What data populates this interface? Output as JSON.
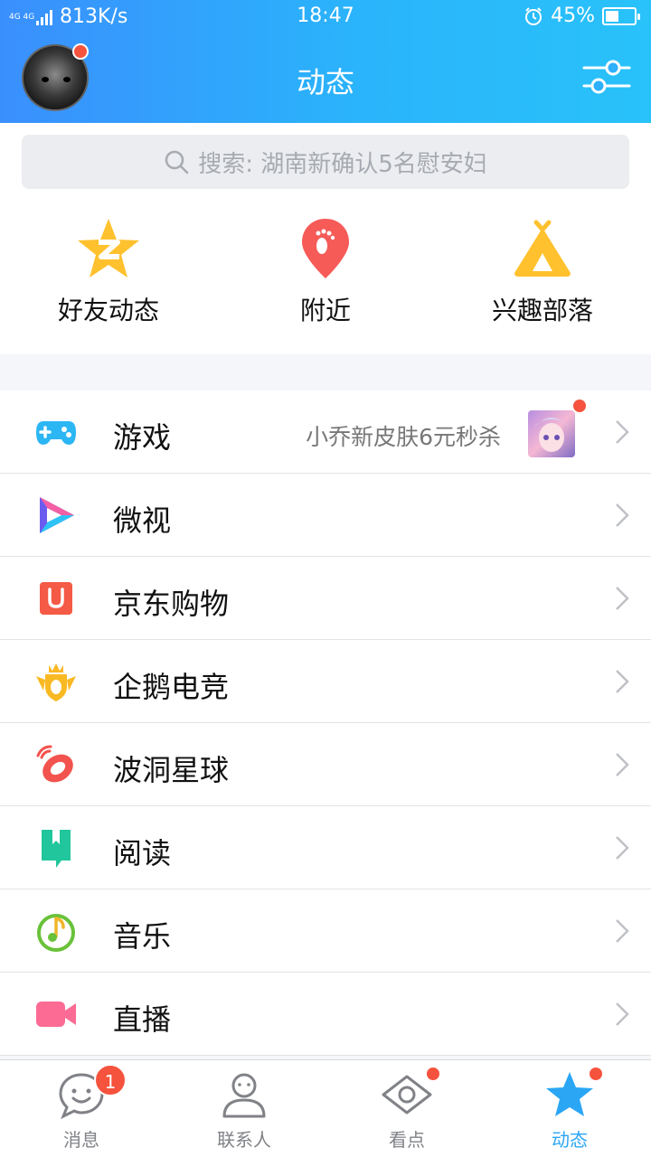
{
  "status_bar": {
    "network_tag": "4G 4G",
    "speed": "813K/s",
    "time": "18:47",
    "battery_percent": "45%",
    "battery_level": 0.45
  },
  "header": {
    "title": "动态"
  },
  "search": {
    "placeholder": "搜索: 湖南新确认5名慰安妇"
  },
  "quick_entries": [
    {
      "label": "好友动态",
      "icon": "friends-feed-star-icon"
    },
    {
      "label": "附近",
      "icon": "nearby-location-icon"
    },
    {
      "label": "兴趣部落",
      "icon": "interest-tribe-tent-icon"
    }
  ],
  "list": [
    {
      "label": "游戏",
      "icon": "gamepad-icon",
      "extra": "小乔新皮肤6元秒杀"
    },
    {
      "label": "微视",
      "icon": "weishi-play-icon"
    },
    {
      "label": "京东购物",
      "icon": "jd-shopping-icon"
    },
    {
      "label": "企鹅电竞",
      "icon": "penguin-esports-icon"
    },
    {
      "label": "波洞星球",
      "icon": "bodong-planet-icon"
    },
    {
      "label": "阅读",
      "icon": "reading-book-icon"
    },
    {
      "label": "音乐",
      "icon": "music-note-icon"
    },
    {
      "label": "直播",
      "icon": "live-camera-icon"
    }
  ],
  "tabs": [
    {
      "label": "消息",
      "icon": "messages-icon",
      "badge": "1"
    },
    {
      "label": "联系人",
      "icon": "contacts-icon"
    },
    {
      "label": "看点",
      "icon": "kandian-eye-icon"
    },
    {
      "label": "动态",
      "icon": "feed-star-icon",
      "active": true
    }
  ],
  "colors": {
    "header_gradient_start": "#3a8ffd",
    "header_gradient_end": "#29c2fa",
    "badge_red": "#f5533d",
    "active_tab": "#2aa6f5"
  }
}
